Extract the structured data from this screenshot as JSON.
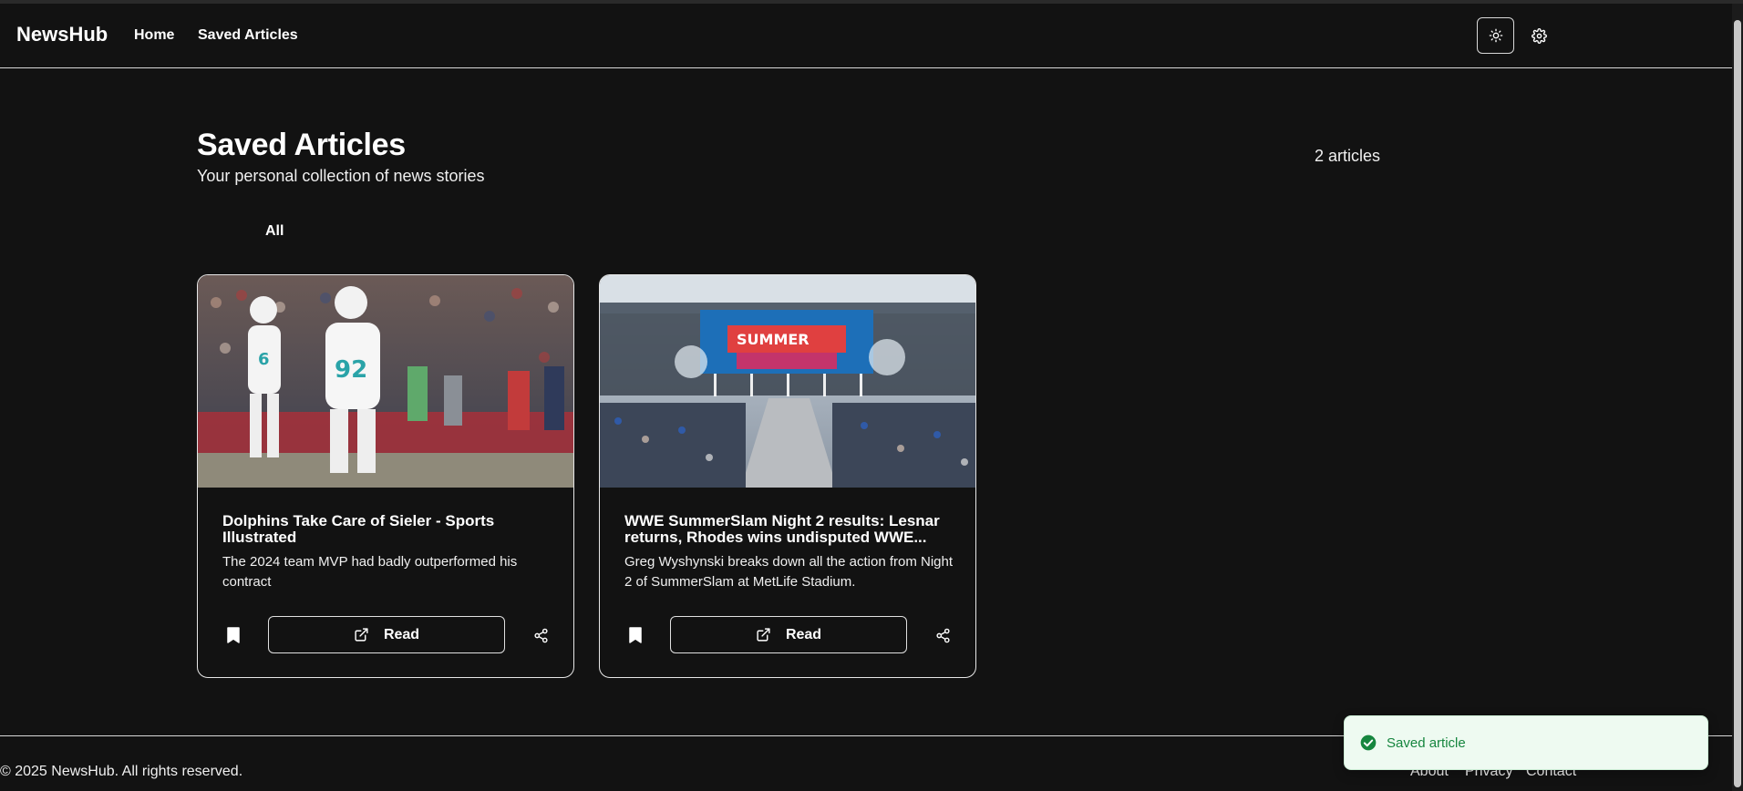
{
  "colors": {
    "background": "#121212",
    "text": "#ffffff",
    "border": "#e7e7e7",
    "toast_bg": "#eefaf1",
    "toast_text": "#16863f",
    "toast_icon": "#16863f"
  },
  "header": {
    "brand": "NewsHub",
    "nav": [
      {
        "label": "Home"
      },
      {
        "label": "Saved Articles"
      }
    ],
    "theme_icon": "sun-icon",
    "settings_icon": "gear-icon"
  },
  "main": {
    "title": "Saved Articles",
    "subtitle": "Your personal collection of news stories",
    "count": "2 articles",
    "filter_tabs": [
      {
        "label": "All"
      }
    ],
    "articles": [
      {
        "image_icon": "football-photo",
        "title": "Dolphins Take Care of Sieler - Sports Illustrated",
        "description": "The 2024 team MVP had badly outperformed his contract",
        "read_label": "Read",
        "bookmark_icon": "bookmark-icon",
        "read_icon": "external-link-icon",
        "share_icon": "share-icon"
      },
      {
        "image_icon": "stadium-photo",
        "title": "WWE SummerSlam Night 2 results: Lesnar returns, Rhodes wins undisputed WWE...",
        "description": "Greg Wyshynski breaks down all the action from Night 2 of SummerSlam at MetLife Stadium.",
        "read_label": "Read",
        "bookmark_icon": "bookmark-icon",
        "read_icon": "external-link-icon",
        "share_icon": "share-icon"
      }
    ]
  },
  "footer": {
    "copyright": "© 2025 NewsHub. All rights reserved.",
    "links": [
      {
        "label": "About"
      },
      {
        "label": "Privacy"
      },
      {
        "label": "Contact"
      }
    ]
  },
  "toast": {
    "text": "Saved article",
    "icon": "check-circle-icon"
  }
}
